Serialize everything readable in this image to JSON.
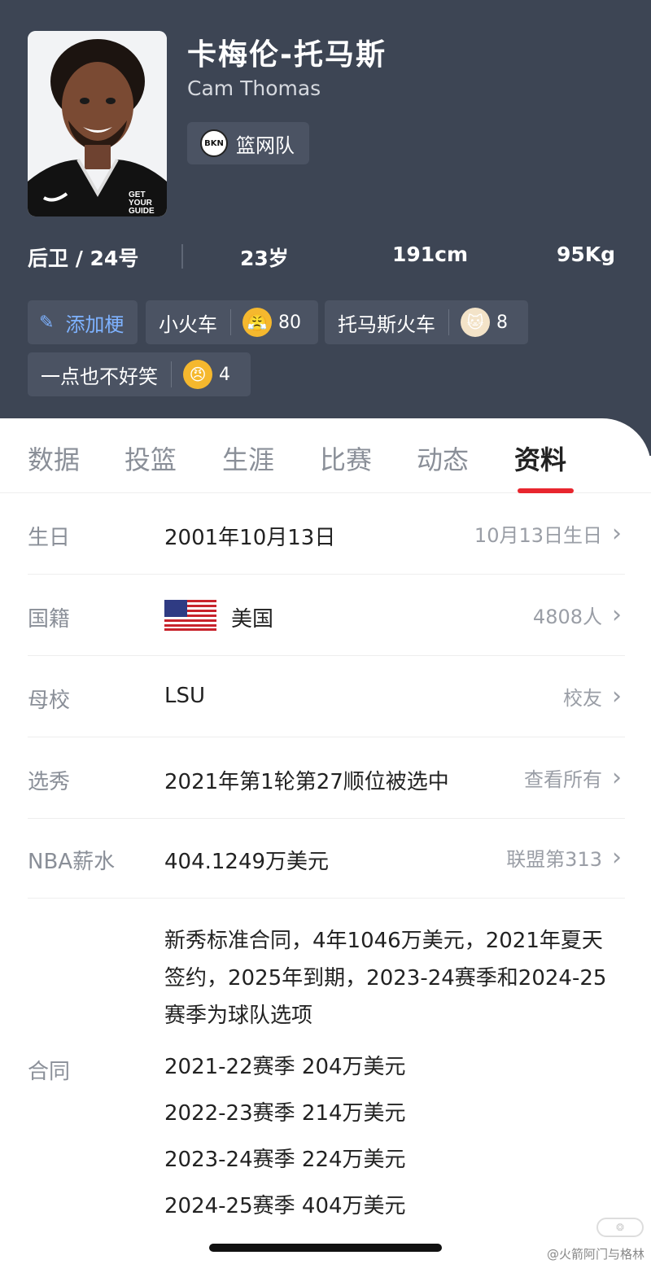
{
  "player": {
    "name_cn": "卡梅伦-托马斯",
    "name_en": "Cam Thomas",
    "team": "篮网队",
    "team_logo_text": "BKN",
    "jersey_text_1": "GET",
    "jersey_text_2": "YOUR",
    "jersey_text_3": "GUIDE"
  },
  "stats": {
    "position": "后卫 / 24号",
    "age": "23岁",
    "height": "191cm",
    "weight": "95Kg"
  },
  "tags": {
    "add_label": "添加梗",
    "items": [
      {
        "label": "小火车",
        "count": "80"
      },
      {
        "label": "托马斯火车",
        "count": "8"
      },
      {
        "label": "一点也不好笑",
        "count": "4"
      }
    ]
  },
  "tabs": [
    "数据",
    "投篮",
    "生涯",
    "比赛",
    "动态",
    "资料"
  ],
  "active_tab": "资料",
  "profile": {
    "birthday": {
      "label": "生日",
      "value": "2001年10月13日",
      "link": "10月13日生日"
    },
    "nationality": {
      "label": "国籍",
      "value": "美国",
      "link": "4808人"
    },
    "college": {
      "label": "母校",
      "value": "LSU",
      "link": "校友"
    },
    "draft": {
      "label": "选秀",
      "value": "2021年第1轮第27顺位被选中",
      "link": "查看所有"
    },
    "salary": {
      "label": "NBA薪水",
      "value": "404.1249万美元",
      "link": "联盟第313"
    },
    "contract": {
      "label": "合同",
      "description": "新秀标准合同，4年1046万美元，2021年夏天签约，2025年到期，2023-24赛季和2024-25赛季为球队选项",
      "years": [
        "2021-22赛季 204万美元",
        "2022-23赛季 214万美元",
        "2023-24赛季 224万美元",
        "2024-25赛季 404万美元"
      ]
    }
  },
  "watermark": "@火箭阿门与格林",
  "colors": {
    "header_bg": "#3d4554",
    "accent_red": "#e8262e",
    "tag_link": "#7eb2ff"
  }
}
